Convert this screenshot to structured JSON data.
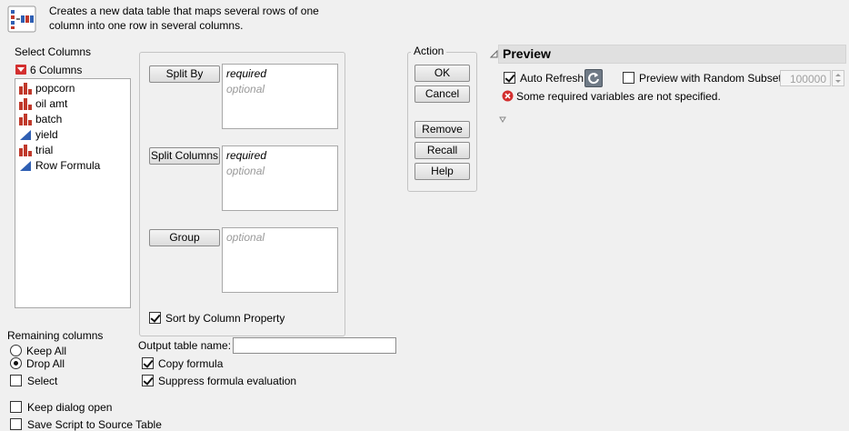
{
  "description": "Creates a new data table that maps several rows of one column into one row in several columns.",
  "select_columns": {
    "title": "Select Columns",
    "count_label": "6 Columns",
    "columns": [
      {
        "name": "popcorn",
        "type": "nominal"
      },
      {
        "name": "oil amt",
        "type": "nominal"
      },
      {
        "name": "batch",
        "type": "nominal"
      },
      {
        "name": "yield",
        "type": "continuous"
      },
      {
        "name": "trial",
        "type": "nominal"
      },
      {
        "name": "Row Formula",
        "type": "continuous"
      }
    ]
  },
  "roles": {
    "split_by": {
      "button": "Split By",
      "required": "required",
      "optional": "optional"
    },
    "split_columns": {
      "button": "Split Columns",
      "required": "required",
      "optional": "optional"
    },
    "group": {
      "button": "Group",
      "optional": "optional"
    },
    "sort_by_column_property": {
      "label": "Sort by Column Property",
      "checked": true
    }
  },
  "remaining_columns": {
    "title": "Remaining columns",
    "options": [
      {
        "label": "Keep All",
        "selected": false
      },
      {
        "label": "Drop All",
        "selected": true
      }
    ],
    "select_label": "Select",
    "select_checked": false
  },
  "output": {
    "table_name_label": "Output table name:",
    "table_name_value": "",
    "copy_formula_label": "Copy formula",
    "copy_formula_checked": true,
    "suppress_label": "Suppress formula evaluation",
    "suppress_checked": true
  },
  "dialog_options": {
    "keep_open_label": "Keep dialog open",
    "keep_open_checked": false,
    "save_script_label": "Save Script to Source Table",
    "save_script_checked": false
  },
  "action": {
    "title": "Action",
    "ok": "OK",
    "cancel": "Cancel",
    "remove": "Remove",
    "recall": "Recall",
    "help": "Help"
  },
  "preview": {
    "title": "Preview",
    "auto_refresh_label": "Auto Refresh",
    "auto_refresh_checked": true,
    "random_subset_label": "Preview with Random Subset",
    "random_subset_checked": false,
    "random_subset_value": "100000",
    "error_message": "Some required variables are not specified."
  },
  "colors": {
    "nominal_icon": "#c0392b",
    "continuous_icon": "#2f5fb3",
    "error_icon": "#d32f2f",
    "preview_header": "#e0e0e0"
  }
}
